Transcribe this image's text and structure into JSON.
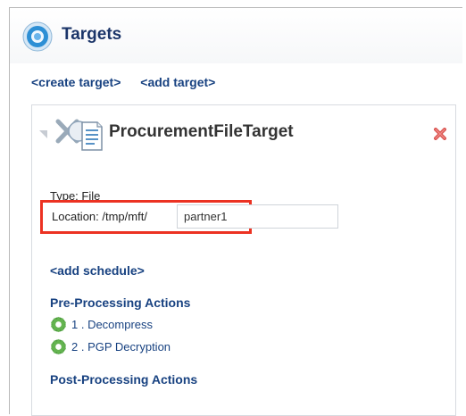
{
  "page": {
    "title": "Targets"
  },
  "links": {
    "create_target": "<create target>",
    "add_target": "<add target>"
  },
  "target": {
    "name": "ProcurementFileTarget",
    "type_line": "Type: File",
    "location_label": "Location: /tmp/mft/",
    "location_value": "partner1"
  },
  "schedule": {
    "add_label": "<add schedule>"
  },
  "pre_processing": {
    "title": "Pre-Processing Actions",
    "items": [
      {
        "label": "1 . Decompress"
      },
      {
        "label": "2 . PGP Decryption"
      }
    ]
  },
  "post_processing": {
    "title": "Post-Processing Actions"
  },
  "colors": {
    "title": "#1b3569",
    "link": "#184281",
    "highlight": "#ec3222",
    "gear": "#55a545",
    "delete": "#d9534f"
  },
  "icons": {
    "page": "target-icon",
    "target": "file-target-icon",
    "delete": "delete-icon",
    "action": "gear-icon"
  }
}
